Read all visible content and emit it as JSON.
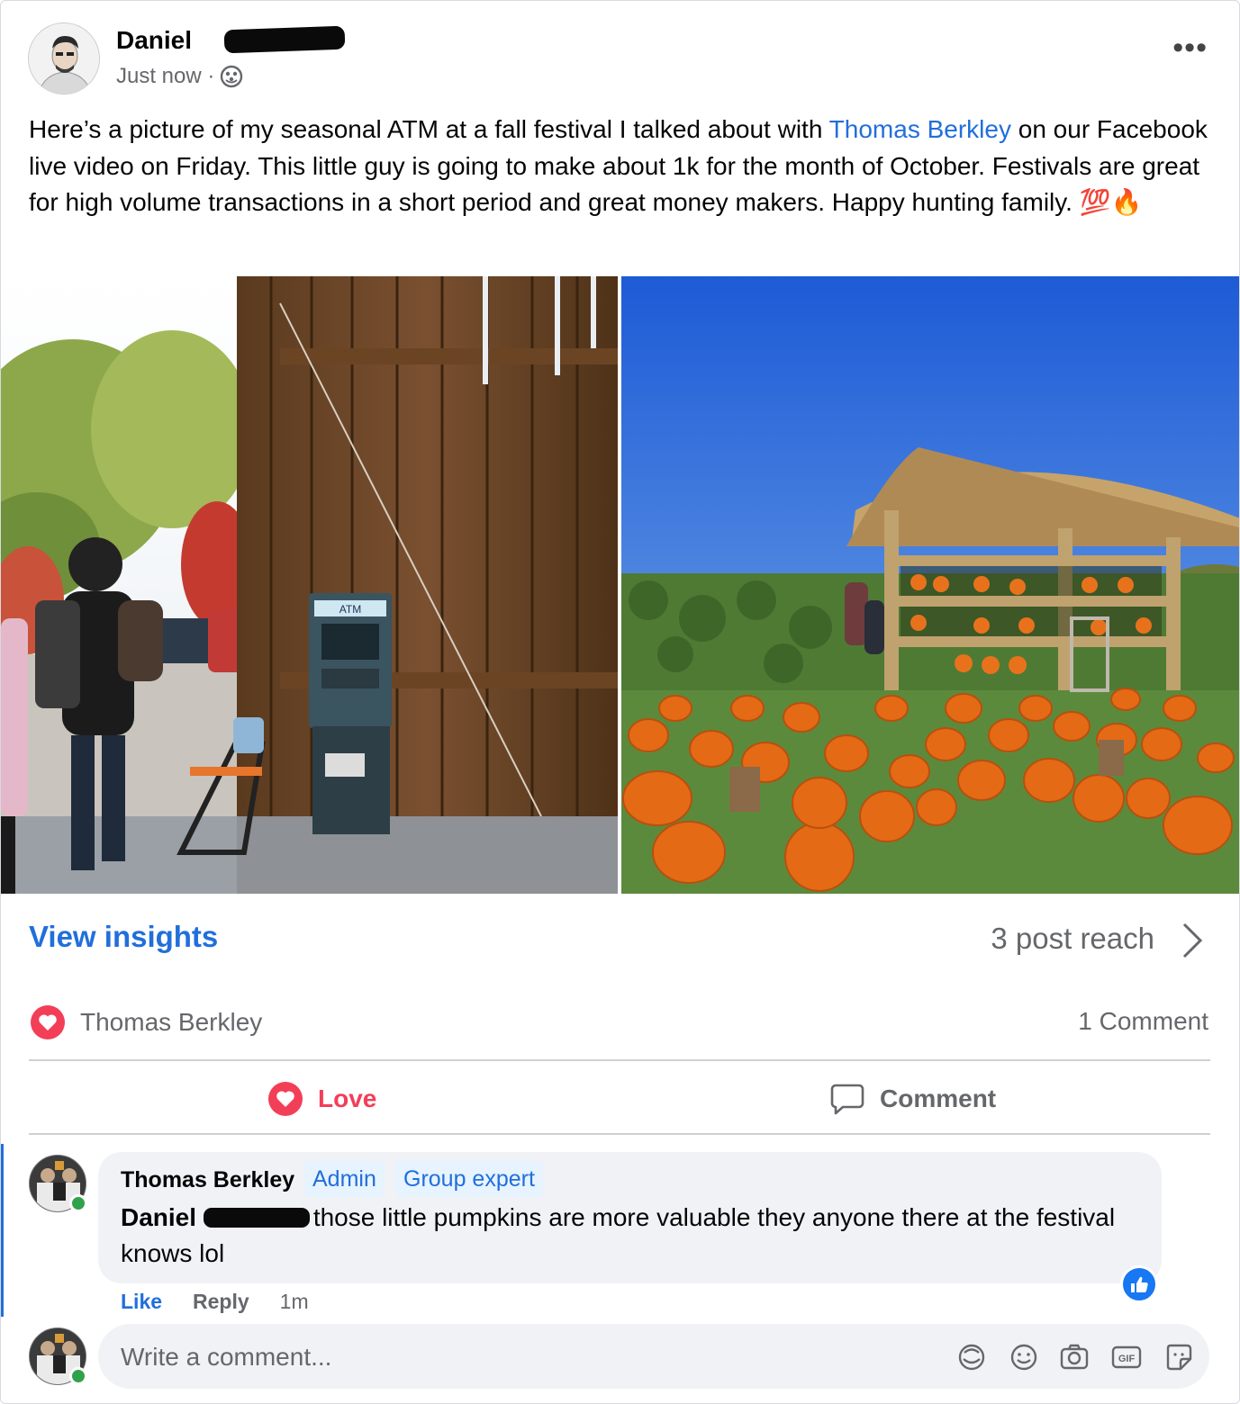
{
  "post": {
    "author": "Daniel",
    "timestamp": "Just now ·",
    "privacy_icon": "group-globe-icon",
    "text_before_mention": "Here’s a picture of my seasonal ATM at a fall festival I talked about with ",
    "mention": "Thomas Berkley",
    "text_after_mention": " on our Facebook live video on Friday.  This little guy is going to make about 1k for the month of October. Festivals are great for high volume transactions in a short period and great money makers. Happy hunting family. 💯🔥",
    "atm_sign": "ATM"
  },
  "insights": {
    "link": "View insights",
    "reach": "3 post reach"
  },
  "reactions": {
    "names": "Thomas Berkley",
    "comment_count": "1 Comment"
  },
  "actions": {
    "love": "Love",
    "comment": "Comment"
  },
  "comment": {
    "author": "Thomas Berkley",
    "badge_admin": "Admin",
    "badge_expert": "Group expert",
    "mention": "Daniel",
    "text": "those little pumpkins are more valuable they anyone there at the festival knows lol",
    "like": "Like",
    "reply": "Reply",
    "time": "1m"
  },
  "composer": {
    "placeholder": "Write a comment..."
  },
  "colors": {
    "link_blue": "#216fdb",
    "love_red": "#f33e58",
    "secondary_text": "#65676b",
    "bubble_bg": "#f0f2f5"
  }
}
